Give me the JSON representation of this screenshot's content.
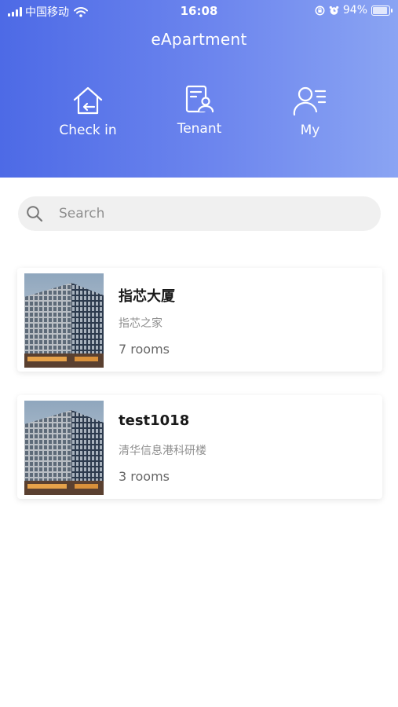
{
  "status_bar": {
    "carrier": "中国移动",
    "time": "16:08",
    "battery": "94%"
  },
  "app": {
    "title": "eApartment"
  },
  "nav": [
    {
      "label": "Check in",
      "icon": "check-in-house-icon"
    },
    {
      "label": "Tenant",
      "icon": "tenant-card-icon"
    },
    {
      "label": "My",
      "icon": "user-profile-icon"
    }
  ],
  "search": {
    "placeholder": "Search",
    "value": "",
    "icon": "search-icon"
  },
  "buildings": [
    {
      "name": "指芯大厦",
      "subtitle": "指芯之家",
      "rooms": "7 rooms"
    },
    {
      "name": "test1018",
      "subtitle": "清华信息港科研楼",
      "rooms": "3 rooms"
    }
  ],
  "colors": {
    "header_gradient_start": "#4d6ae6",
    "header_gradient_end": "#8aa4f3",
    "search_bg": "#f0f0f0"
  }
}
